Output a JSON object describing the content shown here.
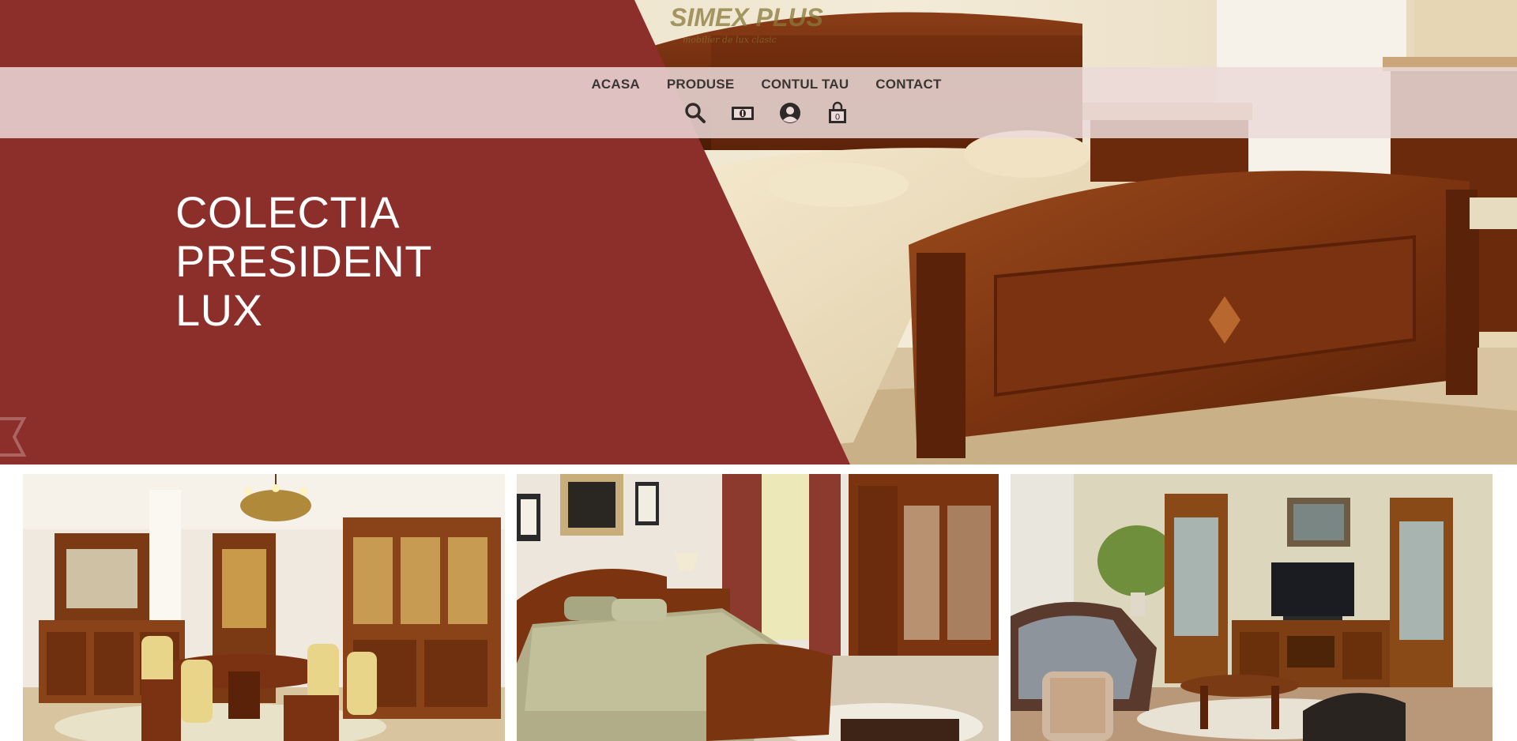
{
  "brand": {
    "name": "SIMEX PLUS",
    "tagline": "mobilier de lux clasic"
  },
  "nav": {
    "links": [
      {
        "label": "ACASA"
      },
      {
        "label": "PRODUSE"
      },
      {
        "label": "CONTUL TAU"
      },
      {
        "label": "CONTACT"
      }
    ],
    "icons": [
      {
        "icon": "search-icon"
      },
      {
        "icon": "currency-icon"
      },
      {
        "icon": "user-account-icon"
      },
      {
        "icon": "shopping-bag-icon",
        "count": "0"
      }
    ]
  },
  "hero": {
    "title_lines": [
      "COLECTIA",
      "PRESIDENT",
      "LUX"
    ],
    "colors": {
      "accent": "#8c2e2a",
      "nav_bg": "#ebdad8"
    }
  },
  "tiles": [
    {
      "name": "dining-room"
    },
    {
      "name": "bedroom"
    },
    {
      "name": "living-room"
    }
  ]
}
